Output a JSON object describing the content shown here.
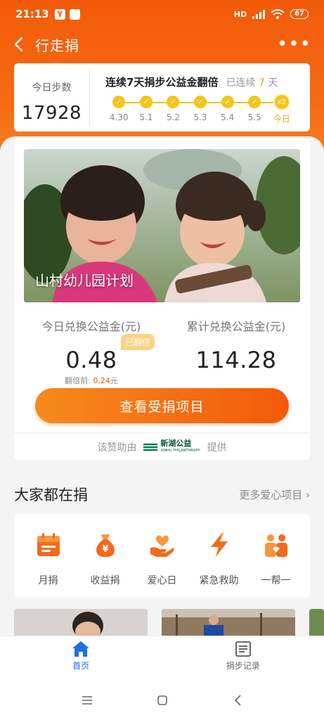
{
  "status": {
    "time": "21:13",
    "battery": "67",
    "network": "HD"
  },
  "nav": {
    "title": "行走捐"
  },
  "steps_card": {
    "today_label": "今日步数",
    "today_steps": "17928",
    "streak_title": "连续7天捐步公益金翻倍",
    "streak_prefix": "已连续",
    "streak_days": "7",
    "streak_unit": "天",
    "days": [
      "4.30",
      "5.1",
      "5.2",
      "5.3",
      "5.4",
      "5.5",
      "今日"
    ],
    "today_badge": "x2"
  },
  "project": {
    "title": "山村幼儿园计划",
    "today_fund_label": "今日兑换公益金(元)",
    "today_fund_value": "0.48",
    "doubled_badge": "已翻倍",
    "before_label": "翻倍前: ",
    "before_value": "0.24",
    "before_unit": "元",
    "total_fund_label": "累计兑换公益金(元)",
    "total_fund_value": "114.28",
    "view_button": "查看受捐项目",
    "sponsor_prefix": "该赞助由",
    "sponsor_name": "新湖公益",
    "sponsor_sub": "XINHU PHILANTHROPY",
    "sponsor_suffix": "提供"
  },
  "section": {
    "title": "大家都在捐",
    "more": "更多爱心项目"
  },
  "categories": [
    {
      "label": "月捐",
      "icon": "calendar-icon"
    },
    {
      "label": "收益捐",
      "icon": "money-bag-icon"
    },
    {
      "label": "爱心日",
      "icon": "heart-hand-icon"
    },
    {
      "label": "紧急救助",
      "icon": "lightning-icon"
    },
    {
      "label": "一帮一",
      "icon": "people-icon"
    }
  ],
  "tabs": [
    {
      "label": "首页",
      "icon": "home-icon",
      "active": true
    },
    {
      "label": "捐步记录",
      "icon": "record-icon",
      "active": false
    }
  ],
  "colors": {
    "brand_orange": "#f25a0a",
    "gold": "#f5c518",
    "active_blue": "#1e6fe6"
  }
}
